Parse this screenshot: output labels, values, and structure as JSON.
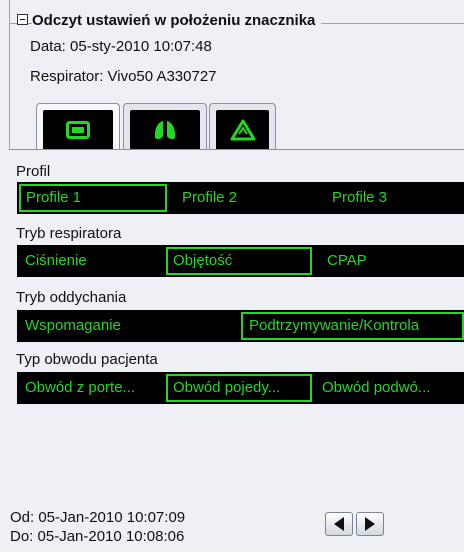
{
  "panel": {
    "title": "Odczyt ustawień w położeniu znacznika",
    "date_line": "Data: 05-sty-2010 10:07:48",
    "respirator_line": "Respirator: Vivo50 A330727"
  },
  "tabs": [
    {
      "icon": "monitor-icon",
      "active": true
    },
    {
      "icon": "lungs-icon",
      "active": false
    },
    {
      "icon": "alarm-triangle-icon",
      "active": false
    }
  ],
  "sections": {
    "profil": {
      "label": "Profil",
      "options": [
        "Profile 1",
        "Profile 2",
        "Profile 3"
      ],
      "selected": "Profile 1"
    },
    "tryb_respiratora": {
      "label": "Tryb respiratora",
      "options": [
        "Ciśnienie",
        "Objętość",
        "CPAP"
      ],
      "selected": "Objętość"
    },
    "tryb_oddychania": {
      "label": "Tryb oddychania",
      "options": [
        "Wspomaganie",
        "Podtrzymywanie/Kontrola"
      ],
      "selected": "Podtrzymywanie/Kontrola"
    },
    "typ_obwodu": {
      "label": "Typ obwodu pacjenta",
      "options": [
        "Obwód z porte...",
        "Obwód pojedy...",
        "Obwód podwó..."
      ],
      "selected": "Obwód pojedy..."
    }
  },
  "footer": {
    "from_line": "Od: 05-Jan-2010 10:07:09",
    "to_line": "Do: 05-Jan-2010 10:08:06"
  },
  "colors": {
    "accent_green": "#22d822",
    "panel_bg": "#eef0f5",
    "bar_bg": "#000000"
  }
}
